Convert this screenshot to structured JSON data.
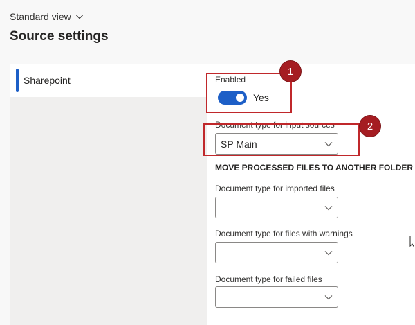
{
  "header": {
    "view_selector_label": "Standard view",
    "page_title": "Source settings"
  },
  "sidebar": {
    "items": [
      {
        "label": "Sharepoint",
        "selected": true
      }
    ]
  },
  "form": {
    "enabled": {
      "label": "Enabled",
      "value_text": "Yes",
      "on": true
    },
    "input_doc_type": {
      "label": "Document type for input sources",
      "value": "SP Main"
    },
    "section_heading": "MOVE PROCESSED FILES TO ANOTHER FOLDER",
    "imported_doc_type": {
      "label": "Document type for imported files",
      "value": ""
    },
    "warnings_doc_type": {
      "label": "Document type for files with warnings",
      "value": ""
    },
    "failed_doc_type": {
      "label": "Document type for failed files",
      "value": ""
    }
  },
  "callouts": [
    {
      "number": "1"
    },
    {
      "number": "2"
    }
  ],
  "colors": {
    "accent": "#1d5fc7",
    "callout_border": "#c0282b",
    "callout_badge": "#a51d22"
  }
}
